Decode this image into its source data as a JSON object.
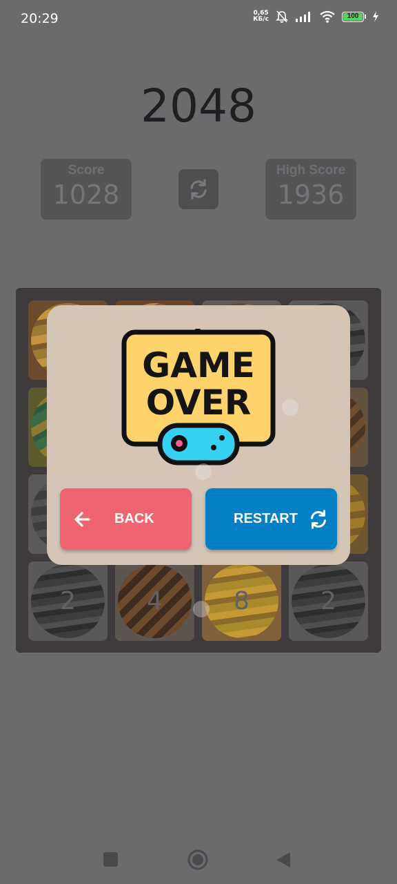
{
  "status_bar": {
    "time": "20:29",
    "net_speed_value": "0,65",
    "net_speed_unit": "КБ/с",
    "battery_level": "100",
    "icons": [
      "mute-bell-icon",
      "signal-icon",
      "wifi-icon",
      "battery-icon",
      "charging-bolt-icon"
    ]
  },
  "game": {
    "title": "2048",
    "score_label": "Score",
    "score_value": "1028",
    "high_score_label": "High Score",
    "high_score_value": "1936",
    "restart_icon": "refresh-icon"
  },
  "board": {
    "grid_size": 4,
    "visible_tiles": [
      {
        "row": 4,
        "col": 1,
        "value": "2",
        "planet": "gray-banded"
      },
      {
        "row": 4,
        "col": 2,
        "value": "4",
        "planet": "brown-striped"
      },
      {
        "row": 4,
        "col": 3,
        "value": "8",
        "planet": "yellow-banded"
      },
      {
        "row": 4,
        "col": 4,
        "value": "2",
        "planet": "gray-banded"
      }
    ]
  },
  "dialog": {
    "image_text_line1": "GAME",
    "image_text_line2": "OVER",
    "image_icon": "game-controller-icon",
    "back_label": "BACK",
    "back_icon": "arrow-left-icon",
    "restart_label": "RESTART",
    "restart_icon": "refresh-icon"
  },
  "colors": {
    "back_button": "#ee6571",
    "restart_button": "#0580c7",
    "dialog_bg": "#d4c5b7",
    "game_over_yellow": "#ffd36b",
    "controller_cyan": "#36d1f0"
  },
  "nav_bar": {
    "icons": [
      "recents-square-icon",
      "home-circle-icon",
      "back-triangle-icon"
    ]
  }
}
